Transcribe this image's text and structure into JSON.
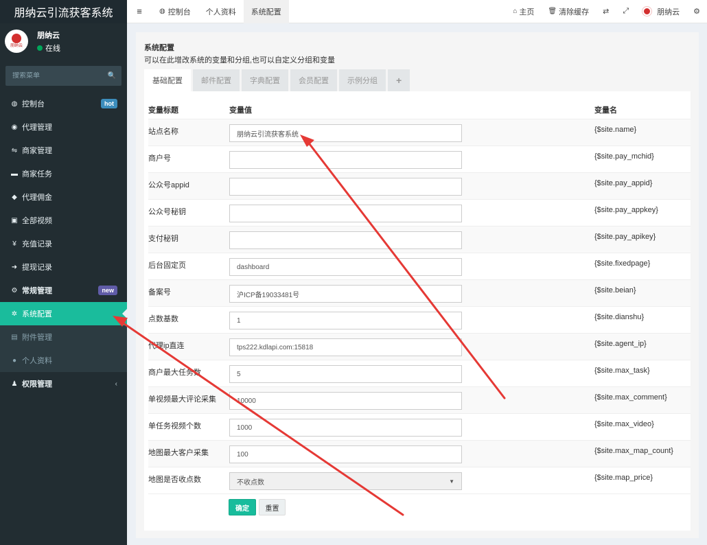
{
  "app": {
    "title": "朋纳云引流获客系统"
  },
  "user": {
    "name": "朋纳云",
    "status": "在线",
    "avatar_text": "朋纳云"
  },
  "search": {
    "placeholder": "搜索菜单"
  },
  "sidebar": {
    "items": [
      {
        "label": "控制台",
        "icon": "dashboard-icon",
        "glyph": "◍",
        "badge": "hot"
      },
      {
        "label": "代理管理",
        "icon": "user-plus-icon",
        "glyph": "◉"
      },
      {
        "label": "商家管理",
        "icon": "handshake-icon",
        "glyph": "⇋"
      },
      {
        "label": "商家任务",
        "icon": "card-icon",
        "glyph": "▬"
      },
      {
        "label": "代理佣金",
        "icon": "diamond-icon",
        "glyph": "◆"
      },
      {
        "label": "全部视频",
        "icon": "video-file-icon",
        "glyph": "▣"
      },
      {
        "label": "充值记录",
        "icon": "yen-icon",
        "glyph": "¥"
      },
      {
        "label": "提现记录",
        "icon": "sign-in-icon",
        "glyph": "➜"
      },
      {
        "label": "常规管理",
        "icon": "cogs-icon",
        "glyph": "⚙",
        "badge": "new"
      },
      {
        "label": "系统配置",
        "icon": "gear-icon",
        "glyph": "✲"
      },
      {
        "label": "附件管理",
        "icon": "file-image-icon",
        "glyph": "▤"
      },
      {
        "label": "个人资料",
        "icon": "user-icon",
        "glyph": "●"
      },
      {
        "label": "权限管理",
        "icon": "group-icon",
        "glyph": "♟"
      }
    ]
  },
  "topbar": {
    "tabs": [
      {
        "label": "控制台",
        "icon": "dashboard-icon"
      },
      {
        "label": "个人资料"
      },
      {
        "label": "系统配置"
      }
    ],
    "right": {
      "home": "主页",
      "clear_cache": "清除缓存",
      "username": "朋纳云"
    }
  },
  "page": {
    "title": "系统配置",
    "description": "可以在此增改系统的变量和分组,也可以自定义分组和变量",
    "tabs": [
      "基础配置",
      "邮件配置",
      "字典配置",
      "会员配置",
      "示例分组",
      "+"
    ]
  },
  "table": {
    "headers": {
      "title": "变量标题",
      "value": "变量值",
      "name": "变量名"
    },
    "rows": [
      {
        "label": "站点名称",
        "value": "朋纳云引流获客系统",
        "name": "{$site.name}"
      },
      {
        "label": "商户号",
        "value": "",
        "name": "{$site.pay_mchid}"
      },
      {
        "label": "公众号appid",
        "value": "",
        "name": "{$site.pay_appid}"
      },
      {
        "label": "公众号秘钥",
        "value": "",
        "name": "{$site.pay_appkey}"
      },
      {
        "label": "支付秘钥",
        "value": "",
        "name": "{$site.pay_apikey}"
      },
      {
        "label": "后台固定页",
        "value": "dashboard",
        "name": "{$site.fixedpage}"
      },
      {
        "label": "备案号",
        "value": "沪ICP备19033481号",
        "name": "{$site.beian}"
      },
      {
        "label": "点数基数",
        "value": "1",
        "name": "{$site.dianshu}"
      },
      {
        "label": "代理ip直连",
        "value": "tps222.kdlapi.com:15818",
        "name": "{$site.agent_ip}"
      },
      {
        "label": "商户最大任务数",
        "value": "5",
        "name": "{$site.max_task}"
      },
      {
        "label": "单视频最大评论采集",
        "value": "10000",
        "name": "{$site.max_comment}"
      },
      {
        "label": "单任务视频个数",
        "value": "1000",
        "name": "{$site.max_video}"
      },
      {
        "label": "地图最大客户采集",
        "value": "100",
        "name": "{$site.max_map_count}"
      },
      {
        "label": "地图是否收点数",
        "value": "不收点数",
        "name": "{$site.map_price}"
      }
    ]
  },
  "buttons": {
    "ok": "确定",
    "reset": "重置"
  },
  "colors": {
    "sidebar_bg": "#222d32",
    "accent": "#1abc9c",
    "annotation_arrow": "#e53935"
  }
}
